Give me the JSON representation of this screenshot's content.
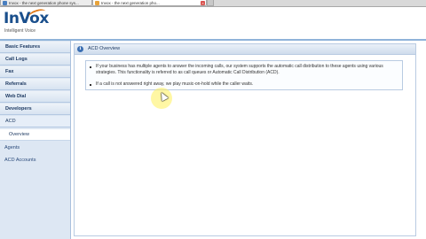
{
  "browser": {
    "tabs": [
      {
        "label": "Invox - the next generation phone sys...",
        "active": false
      },
      {
        "label": "Invox - the next generation pho...",
        "active": true
      }
    ]
  },
  "header": {
    "logo_text": "InVox",
    "tagline": "Intelligent Voice"
  },
  "sidebar": {
    "items": [
      {
        "label": "Basic Features"
      },
      {
        "label": "Call Logs"
      },
      {
        "label": "Fax"
      },
      {
        "label": "Referrals"
      },
      {
        "label": "Web Dial"
      },
      {
        "label": "Developers"
      },
      {
        "label": "ACD"
      },
      {
        "label": "Overview"
      },
      {
        "label": "Agents"
      },
      {
        "label": "ACD Accounts"
      }
    ]
  },
  "panel": {
    "title": "ACD Overview",
    "bullets": [
      "If your business has multiple agents to answer the incoming calls, our system supports the automatic call distribution to these agents using various strategies. This functionality is referred to as call queues or Automatic Call Distribution (ACD).",
      "If a call is not answered right away, we play music-on-hold while the caller waits."
    ]
  },
  "colors": {
    "brand": "#1a4f8c",
    "accent": "#e07a1a",
    "sidebar_bg": "#dde7f3"
  }
}
